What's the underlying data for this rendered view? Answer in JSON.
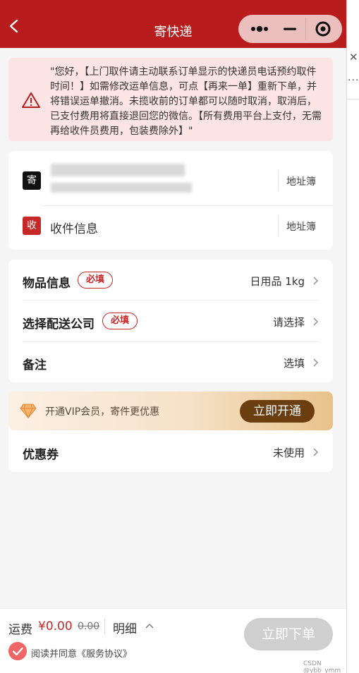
{
  "header": {
    "title": "寄快递"
  },
  "notice": {
    "text": "\"您好，【上门取件请主动联系订单显示的快递员电话预约取件时间！】如需修改运单信息，可点【再来一单】重新下单，并将错误运单撤消。未揽收前的订单都可以随时取消，取消后，已支付费用将直接退回您的微信。【所有费用平台上支付，无需再给收件员费用，包装费除外】\""
  },
  "address": {
    "send_tag": "寄",
    "recv_tag": "收",
    "recv_label": "收件信息",
    "book_label": "地址簿"
  },
  "item": {
    "goods_label": "物品信息",
    "required_badge": "必填",
    "goods_value": "日用品 1kg",
    "company_label": "选择配送公司",
    "company_value": "请选择",
    "remark_label": "备注",
    "remark_value": "选填"
  },
  "vip": {
    "text": "开通VIP会员，寄件更优惠",
    "button": "立即开通",
    "coupon_label": "优惠券",
    "coupon_value": "未使用"
  },
  "bottom": {
    "fee_label": "运费",
    "fee_value": "¥0.00",
    "fee_original": "0.00",
    "detail_label": "明细",
    "order_button": "立即下单",
    "agree_text": "阅读并同意《服务协议》"
  },
  "watermark": "CSDN @ybb_ymm",
  "colors": {
    "brand_red": "#b91c1c",
    "vip_brown": "#6b3e10",
    "disabled_gray": "#cfcfcf"
  }
}
